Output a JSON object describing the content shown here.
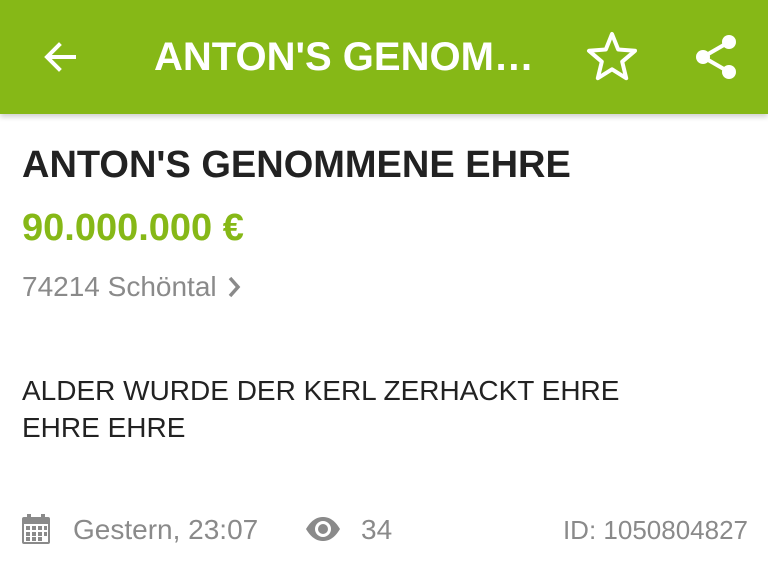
{
  "app_bar": {
    "title": "ANTON'S GENOMMENE EHRE",
    "back_icon": "arrow-left-icon",
    "favorite_icon": "star-outline-icon",
    "share_icon": "share-icon",
    "background_color": "#86b817"
  },
  "listing": {
    "title": "ANTON'S GENOMMENE EHRE",
    "price": "90.000.000 €",
    "price_color": "#86b817",
    "location": "74214 Schöntal",
    "description": "ALDER WURDE DER KERL ZERHACKT EHRE EHRE EHRE"
  },
  "meta": {
    "date": "Gestern, 23:07",
    "views": "34",
    "id": "ID: 1050804827",
    "date_icon": "calendar-icon",
    "views_icon": "eye-icon"
  }
}
